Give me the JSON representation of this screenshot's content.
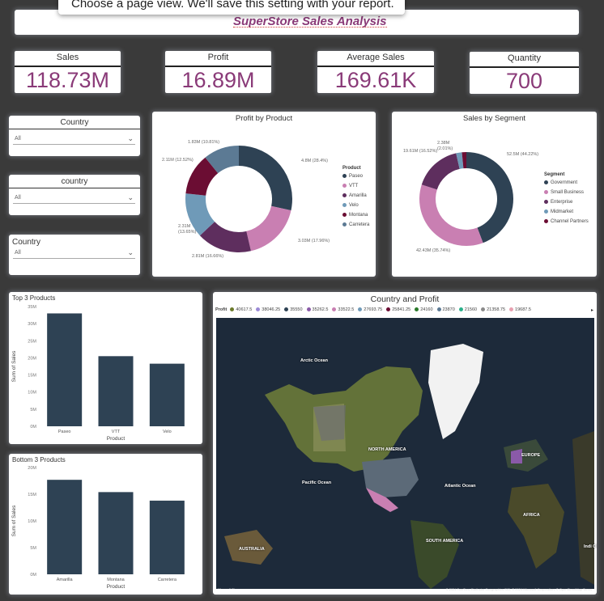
{
  "notification": {
    "text": "Choose a page view. We'll save this setting with your report."
  },
  "header": {
    "title": "SuperStore Sales Analysis"
  },
  "kpis": [
    {
      "label": "Sales",
      "value": "118.73M"
    },
    {
      "label": "Profit",
      "value": "16.89M"
    },
    {
      "label": "Average Sales",
      "value": "169.61K"
    },
    {
      "label": "Quantity",
      "value": "700"
    }
  ],
  "slicers": [
    {
      "title": "Country",
      "value": "All"
    },
    {
      "title": "country",
      "value": "All"
    },
    {
      "title": "Country",
      "value": "All"
    }
  ],
  "colors": {
    "navy": "#2e4254",
    "pink": "#c97fb2",
    "plum": "#5e2e5e",
    "steel": "#6f9ab8",
    "maroon": "#6b0d33",
    "slate": "#5c7a94",
    "bar": "#2e4254",
    "accent": "#8a3a78"
  },
  "profit_by_product": {
    "title": "Profit by Product",
    "legend_title": "Product",
    "legend": [
      "Paseo",
      "VTT",
      "Amarilla",
      "Velo",
      "Montana",
      "Carretera"
    ],
    "labels": [
      "4.8M (28.4%)",
      "3.03M (17.96%)",
      "2.81M (16.66%)",
      "2.31M (13.65%)",
      "2.11M (12.52%)",
      "1.83M (10.81%)"
    ]
  },
  "sales_by_segment": {
    "title": "Sales by Segment",
    "legend_title": "Segment",
    "legend": [
      "Government",
      "Small Business",
      "Enterprise",
      "Midmarket",
      "Channel Partners"
    ],
    "labels": [
      "52.5M (44.22%)",
      "42.43M (35.74%)",
      "19.61M (16.52%)",
      "2.38M (2.01%)"
    ]
  },
  "top3": {
    "title": "Top 3 Products",
    "ylabel": "Sum of Sales",
    "xlabel": "Product"
  },
  "bottom3": {
    "title": "Bottom 3 Products",
    "ylabel": "Sum of Sales",
    "xlabel": "Product"
  },
  "map": {
    "title": "Country and Profit",
    "legend_title": "Profit",
    "legend_values": [
      "40617.5",
      "38046.25",
      "35550",
      "35262.5",
      "33522.5",
      "27693.75",
      "25841.25",
      "24160",
      "23870",
      "21560",
      "21358.75",
      "19687.5"
    ],
    "legend_colors": [
      "#6b7a2a",
      "#9b8ad6",
      "#2e4254",
      "#8a5aa8",
      "#c97fb2",
      "#6f9ab8",
      "#6b0d33",
      "#2a7a2a",
      "#5c7a94",
      "#2ab08a",
      "#8a8a8a",
      "#e8a0b0"
    ],
    "labels": {
      "arctic": "Arctic Ocean",
      "north_america": "NORTH AMERICA",
      "pacific": "Pacific Ocean",
      "atlantic": "Atlantic Ocean",
      "europe": "EUROPE",
      "africa": "AFRICA",
      "south_america": "SOUTH AMERICA",
      "australia": "AUSTRALIA",
      "indian": "Indi O"
    },
    "attribution": "© 2024 TomTom, Earthstar Geographics SIO, © 2024 Microsoft Corporation, © OpenStreetMap  Terms",
    "bing": "Microsoft Bing"
  },
  "chart_data": [
    {
      "type": "pie",
      "title": "Profit by Product",
      "categories": [
        "Paseo",
        "VTT",
        "Amarilla",
        "Velo",
        "Montana",
        "Carretera"
      ],
      "values": [
        4.8,
        3.03,
        2.81,
        2.31,
        2.11,
        1.83
      ],
      "percent": [
        28.4,
        17.96,
        16.66,
        13.65,
        12.52,
        10.81
      ],
      "unit": "M",
      "donut": true,
      "legend": "right"
    },
    {
      "type": "pie",
      "title": "Sales by Segment",
      "categories": [
        "Government",
        "Small Business",
        "Enterprise",
        "Midmarket",
        "Channel Partners"
      ],
      "values": [
        52.5,
        42.43,
        19.61,
        2.38,
        1.8
      ],
      "percent": [
        44.22,
        35.74,
        16.52,
        2.01,
        1.51
      ],
      "unit": "M",
      "donut": true,
      "legend": "right"
    },
    {
      "type": "bar",
      "title": "Top 3 Products",
      "categories": [
        "Paseo",
        "VTT",
        "Velo"
      ],
      "values": [
        33,
        20.5,
        18.3
      ],
      "unit": "M",
      "xlabel": "Product",
      "ylabel": "Sum of Sales",
      "ylim": [
        0,
        35
      ],
      "yticks": [
        "0M",
        "5M",
        "10M",
        "15M",
        "20M",
        "25M",
        "30M",
        "35M"
      ]
    },
    {
      "type": "bar",
      "title": "Bottom 3 Products",
      "categories": [
        "Amarilla",
        "Montana",
        "Carretera"
      ],
      "values": [
        17.7,
        15.4,
        13.8
      ],
      "unit": "M",
      "xlabel": "Product",
      "ylabel": "Sum of Sales",
      "ylim": [
        0,
        20
      ],
      "yticks": [
        "0M",
        "5M",
        "10M",
        "15M",
        "20M"
      ]
    }
  ]
}
